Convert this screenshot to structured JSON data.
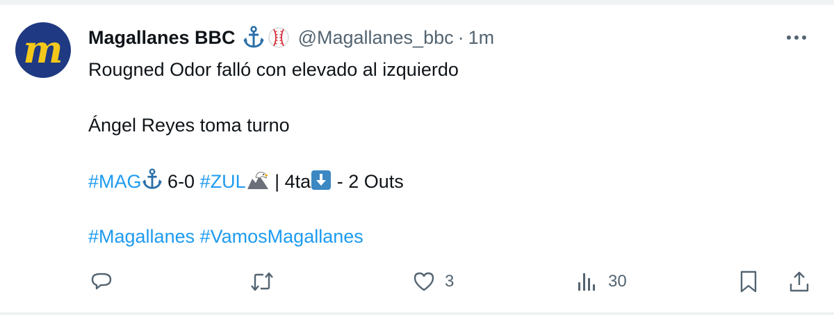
{
  "tweet": {
    "author": {
      "name": "Magallanes BBC",
      "badges": [
        "anchor-icon",
        "baseball-icon"
      ],
      "handle": "@Magallanes_bbc",
      "separator": "·",
      "time": "1m",
      "avatar_letter": "m",
      "avatar_bg": "#1f3a82",
      "avatar_fg": "#f4c81b"
    },
    "lines": {
      "line1": "Rougned Odor falló con elevado al izquierdo",
      "line2": "Ángel Reyes toma turno",
      "score": {
        "team1_tag": "#MAG",
        "score": "6-0",
        "team2_tag": "#ZUL",
        "inning_text": "| 4ta",
        "outs_text": "- 2 Outs"
      },
      "tags": {
        "tag1": "#Magallanes",
        "tag2": "#VamosMagallanes"
      }
    },
    "actions": {
      "reply_count": "",
      "retweet_count": "",
      "like_count": "3",
      "views_count": "30"
    }
  },
  "colors": {
    "text": "#0f1419",
    "secondary": "#536471",
    "link": "#1d9bf0",
    "divider": "#eff3f4"
  }
}
